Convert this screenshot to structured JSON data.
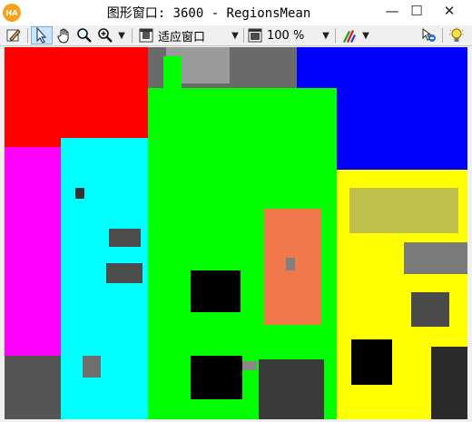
{
  "window": {
    "app_icon": "HA",
    "title": "图形窗口: 3600 - RegionsMean",
    "minimize_glyph": "—",
    "maximize_glyph": "☐",
    "close_glyph": "✕"
  },
  "toolbar": {
    "zoom_fit_label": "适应窗口",
    "zoom_percent": "100 %",
    "dropdown_glyph": "▼"
  },
  "colors": {
    "red_region": "#ff0000",
    "blue_region": "#0000ff",
    "magenta_region": "#ff00ff",
    "cyan_region": "#00ffff",
    "green_region": "#00ff00",
    "yellow_region": "#ffff00",
    "orange_region": "#f0784a"
  }
}
